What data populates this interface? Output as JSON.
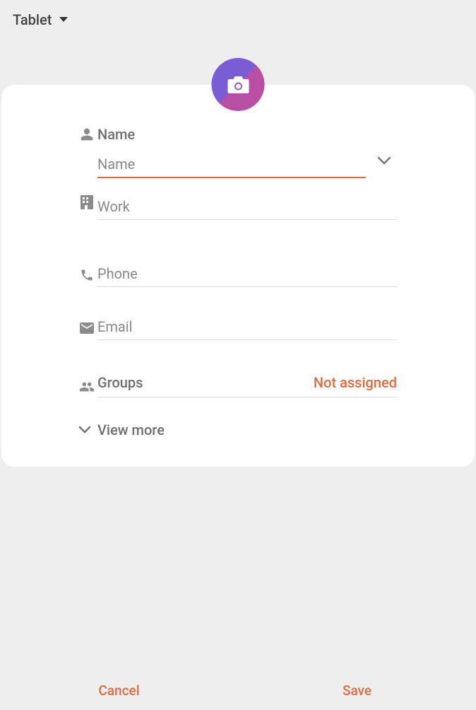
{
  "header": {
    "storage_label": "Tablet"
  },
  "fields": {
    "name_section_label": "Name",
    "name_placeholder": "Name",
    "name_value": "",
    "work_placeholder": "Work",
    "work_value": "",
    "phone_placeholder": "Phone",
    "phone_value": "",
    "email_placeholder": "Email",
    "email_value": "",
    "groups_label": "Groups",
    "groups_value": "Not assigned",
    "view_more_label": "View more"
  },
  "footer": {
    "cancel": "Cancel",
    "save": "Save"
  },
  "colors": {
    "accent": "#e36a3d"
  }
}
